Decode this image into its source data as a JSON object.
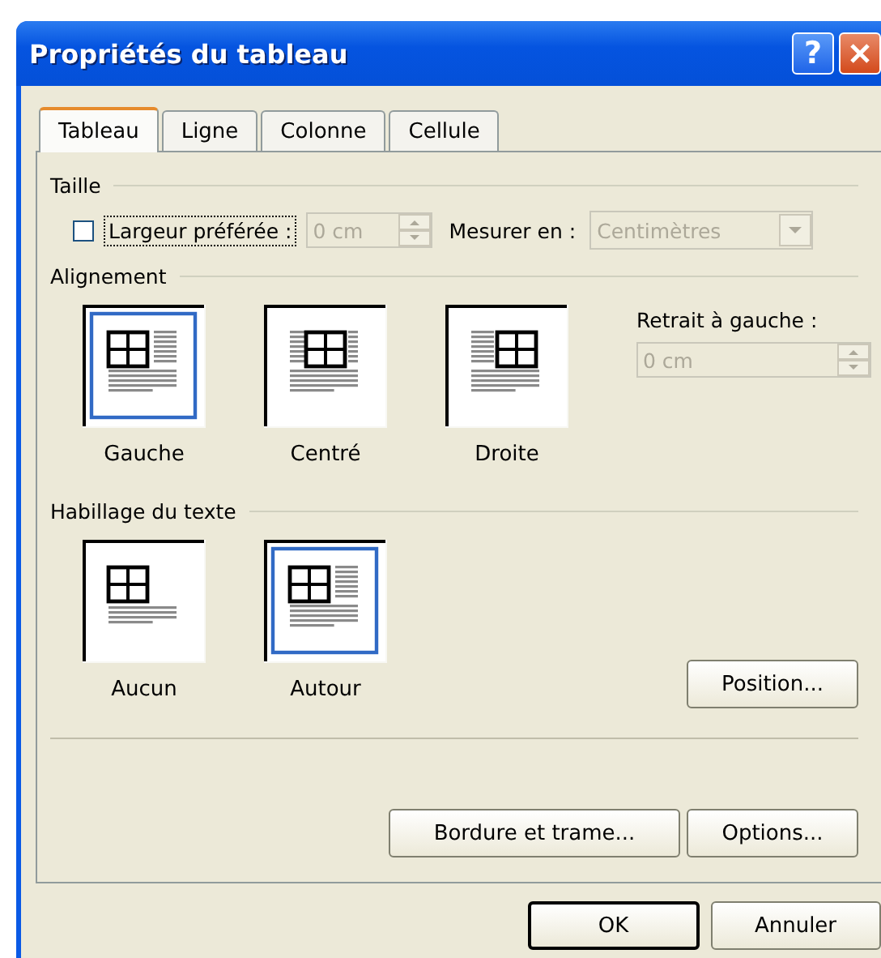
{
  "window": {
    "title": "Propriétés du tableau"
  },
  "title_buttons": [
    {
      "kind": "help",
      "label": "?"
    },
    {
      "kind": "close"
    }
  ],
  "tabs": [
    {
      "label": "Tableau",
      "selected": true
    },
    {
      "label": "Ligne",
      "selected": false
    },
    {
      "label": "Colonne",
      "selected": false
    },
    {
      "label": "Cellule",
      "selected": false
    }
  ],
  "size": {
    "title": "Taille",
    "preferred_width": {
      "label": "Largeur préférée :",
      "checked": false,
      "value": "0 cm",
      "disabled": true
    },
    "measure_in": {
      "label": "Mesurer en :",
      "value": "Centimètres",
      "disabled": true
    }
  },
  "alignment": {
    "title": "Alignement",
    "options": [
      {
        "label": "Gauche",
        "kind": "left",
        "selected": true
      },
      {
        "label": "Centré",
        "kind": "center",
        "selected": false
      },
      {
        "label": "Droite",
        "kind": "right",
        "selected": false
      }
    ],
    "indent": {
      "label": "Retrait à gauche :",
      "value": "0 cm",
      "disabled": true
    }
  },
  "wrapping": {
    "title": "Habillage du texte",
    "options": [
      {
        "label": "Aucun",
        "kind": "none",
        "selected": false
      },
      {
        "label": "Autour",
        "kind": "around",
        "selected": true
      }
    ],
    "position_button": "Position..."
  },
  "panel_buttons": [
    "Bordure et trame...",
    "Options..."
  ],
  "dialog_buttons": [
    {
      "label": "OK",
      "default": true
    },
    {
      "label": "Annuler",
      "default": false
    }
  ]
}
